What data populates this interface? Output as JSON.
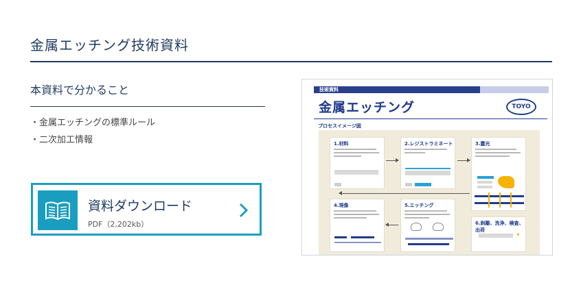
{
  "header": {
    "title": "金属エッチング技術資料"
  },
  "summary": {
    "heading": "本資料で分かること",
    "items": [
      "金属エッチングの標準ルール",
      "二次加工情報"
    ]
  },
  "download": {
    "label": "資料ダウンロード",
    "meta": "PDF（2,202kb）",
    "icon": "book-icon",
    "accent": "#1a9ec0"
  },
  "preview": {
    "tag": "技術資料",
    "title": "金属エッチング",
    "logo": "TOYO",
    "section": "プロセスイメージ図",
    "steps": [
      "1.材料",
      "2.レジストラミネート",
      "3.露光",
      "4.現像",
      "5.エッチング",
      "6.剥離、洗浄、検査、出荷"
    ]
  },
  "colors": {
    "navy": "#1f3a5f",
    "brand": "#1f3a8c",
    "accent": "#1a9ec0"
  }
}
